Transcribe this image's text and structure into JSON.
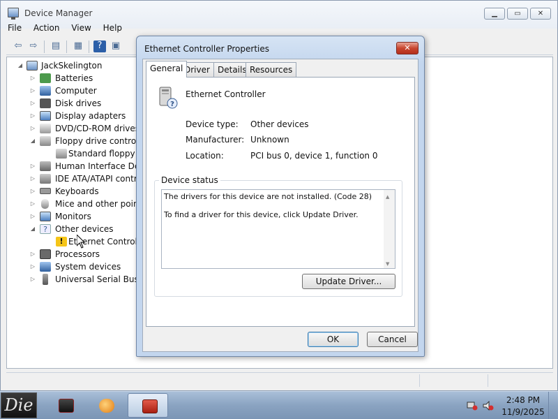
{
  "window": {
    "title": "Device Manager",
    "minimize_label": "▁",
    "maximize_label": "▭",
    "close_label": "✕"
  },
  "menu": [
    "File",
    "Action",
    "View",
    "Help"
  ],
  "toolbar": {
    "back_icon": "⇦",
    "forward_icon": "⇨",
    "tree_icon": "▤",
    "properties_icon": "▦",
    "help_icon": "?",
    "console_icon": "▣"
  },
  "tree": {
    "root": "JackSkelington",
    "items": [
      {
        "label": "Batteries",
        "icon": "battery-icon"
      },
      {
        "label": "Computer",
        "icon": "computer-icon"
      },
      {
        "label": "Disk drives",
        "icon": "disk-drive-icon"
      },
      {
        "label": "Display adapters",
        "icon": "display-adapter-icon"
      },
      {
        "label": "DVD/CD-ROM drives",
        "icon": "dvd-drive-icon"
      },
      {
        "label": "Floppy drive controllers",
        "icon": "floppy-controller-icon"
      },
      {
        "label": "Standard floppy disk controller",
        "icon": "floppy-device-icon"
      },
      {
        "label": "Human Interface Devices",
        "icon": "hid-icon"
      },
      {
        "label": "IDE ATA/ATAPI controllers",
        "icon": "ide-icon"
      },
      {
        "label": "Keyboards",
        "icon": "keyboard-icon"
      },
      {
        "label": "Mice and other pointing devices",
        "icon": "mouse-icon"
      },
      {
        "label": "Monitors",
        "icon": "monitor-icon"
      },
      {
        "label": "Other devices",
        "icon": "unknown-device-icon"
      },
      {
        "label": "Ethernet Controller",
        "icon": "warning-device-icon"
      },
      {
        "label": "Processors",
        "icon": "processor-icon"
      },
      {
        "label": "System devices",
        "icon": "system-device-icon"
      },
      {
        "label": "Universal Serial Bus controllers",
        "icon": "usb-icon"
      }
    ]
  },
  "dialog": {
    "title": "Ethernet Controller Properties",
    "close_label": "✕",
    "tabs": [
      "General",
      "Driver",
      "Details",
      "Resources"
    ],
    "active_tab": "General",
    "device_name": "Ethernet Controller",
    "properties": [
      {
        "key": "Device type:",
        "value": "Other devices"
      },
      {
        "key": "Manufacturer:",
        "value": "Unknown"
      },
      {
        "key": "Location:",
        "value": "PCI bus 0, device 1, function 0"
      }
    ],
    "status_legend": "Device status",
    "status_lines": [
      "The drivers for this device are not installed. (Code 28)",
      "To find a driver for this device, click Update Driver."
    ],
    "update_driver_label": "Update Driver...",
    "ok_label": "OK",
    "cancel_label": "Cancel"
  },
  "taskbar": {
    "start_label": "Die",
    "time": "2:48 PM",
    "date": "11/9/2025"
  },
  "colors": {
    "selection_blue": "#3d7bad",
    "close_red": "#c8462f",
    "warning_yellow": "#f5c518"
  }
}
